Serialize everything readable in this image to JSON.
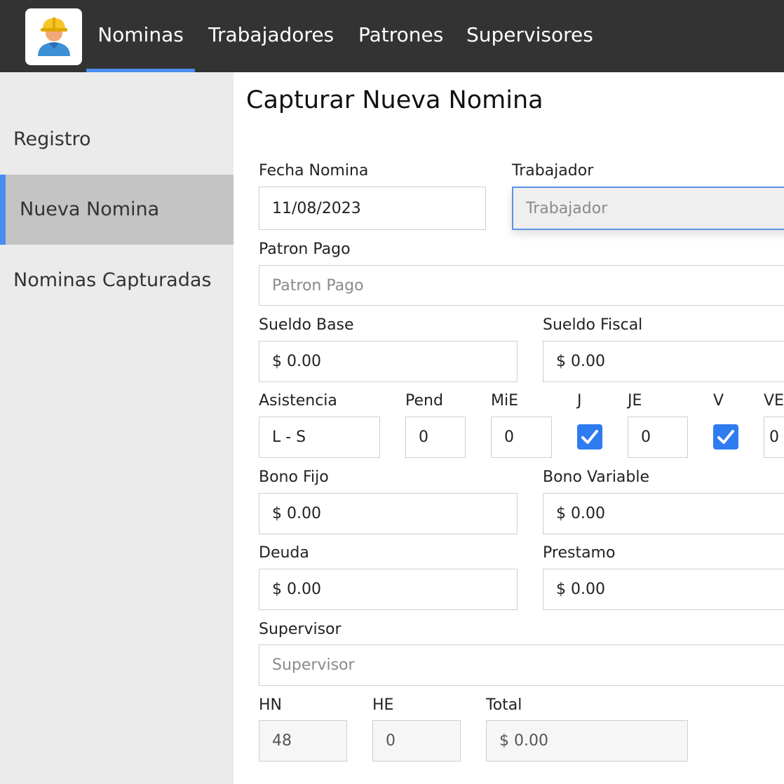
{
  "nav": {
    "tabs": [
      {
        "label": "Nominas",
        "active": true
      },
      {
        "label": "Trabajadores",
        "active": false
      },
      {
        "label": "Patrones",
        "active": false
      },
      {
        "label": "Supervisores",
        "active": false
      }
    ],
    "logo_icon": "construction-worker-icon"
  },
  "sidebar": {
    "items": [
      {
        "label": "Registro",
        "active": false
      },
      {
        "label": "Nueva Nomina",
        "active": true
      },
      {
        "label": "Nominas Capturadas",
        "active": false
      }
    ]
  },
  "form": {
    "title": "Capturar Nueva Nomina",
    "fecha": {
      "label": "Fecha Nomina",
      "value": "11/08/2023"
    },
    "trabajador": {
      "label": "Trabajador",
      "placeholder": "Trabajador"
    },
    "patron": {
      "label": "Patron Pago",
      "placeholder": "Patron Pago"
    },
    "sueldo_base": {
      "label": "Sueldo Base",
      "value": "$ 0.00"
    },
    "sueldo_fiscal": {
      "label": "Sueldo Fiscal",
      "value": "$ 0.00"
    },
    "asistencia": {
      "label": "Asistencia",
      "value": "L - S"
    },
    "pend": {
      "label": "Pend",
      "value": "0"
    },
    "mie": {
      "label": "MiE",
      "value": "0"
    },
    "j": {
      "label": "J",
      "checked": true
    },
    "je": {
      "label": "JE",
      "value": "0"
    },
    "v": {
      "label": "V",
      "checked": true
    },
    "ve": {
      "label": "VE",
      "value": "0"
    },
    "bono_fijo": {
      "label": "Bono Fijo",
      "value": "$ 0.00"
    },
    "bono_variable": {
      "label": "Bono Variable",
      "value": "$ 0.00"
    },
    "deuda": {
      "label": "Deuda",
      "value": "$ 0.00"
    },
    "prestamo": {
      "label": "Prestamo",
      "value": "$ 0.00"
    },
    "supervisor": {
      "label": "Supervisor",
      "placeholder": "Supervisor"
    },
    "hn": {
      "label": "HN",
      "value": "48"
    },
    "he": {
      "label": "HE",
      "value": "0"
    },
    "total": {
      "label": "Total",
      "value": "$ 0.00"
    }
  },
  "colors": {
    "topbar": "#333333",
    "accent": "#4a8cf0",
    "sidebar": "#ebebeb",
    "checkbox": "#2f7bf0"
  }
}
